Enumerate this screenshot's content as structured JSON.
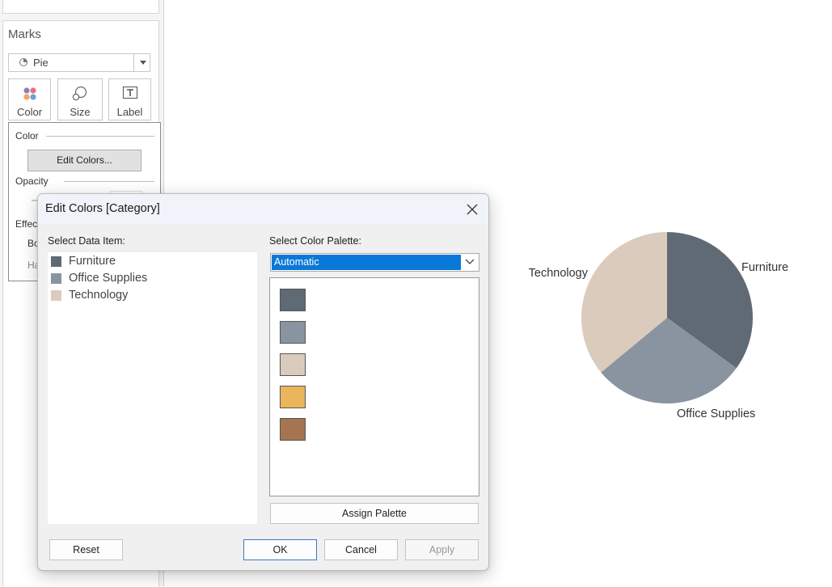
{
  "marks_panel": {
    "title": "Marks",
    "mark_type": "Pie",
    "buttons": [
      {
        "label": "Color",
        "icon": "color-dots-icon"
      },
      {
        "label": "Size",
        "icon": "size-circles-icon"
      },
      {
        "label": "Label",
        "icon": "label-t-icon"
      }
    ],
    "color_popup": {
      "color_section": "Color",
      "edit_colors_label": "Edit Colors...",
      "opacity_section": "Opacity",
      "effects_partial": "Effec",
      "border_partial": "Bo",
      "halo_partial": "Ha"
    }
  },
  "dialog": {
    "title": "Edit Colors [Category]",
    "select_item_label": "Select Data Item:",
    "select_palette_label": "Select Color Palette:",
    "palette_value": "Automatic",
    "items": [
      {
        "label": "Furniture",
        "color": "#5f6a75"
      },
      {
        "label": "Office Supplies",
        "color": "#8a94a1"
      },
      {
        "label": "Technology",
        "color": "#dacbbc"
      }
    ],
    "palette_colors": [
      "#5f6a75",
      "#8a94a1",
      "#dacbbc",
      "#ebb55e",
      "#a47550"
    ],
    "assign_label": "Assign Palette",
    "reset_label": "Reset",
    "ok_label": "OK",
    "cancel_label": "Cancel",
    "apply_label": "Apply"
  },
  "chart_data": {
    "type": "pie",
    "slices": [
      {
        "label": "Furniture",
        "value": 0.35,
        "color": "#5f6a75"
      },
      {
        "label": "Office Supplies",
        "value": 0.29,
        "color": "#8a94a1"
      },
      {
        "label": "Technology",
        "value": 0.36,
        "color": "#dacbbc"
      }
    ]
  }
}
